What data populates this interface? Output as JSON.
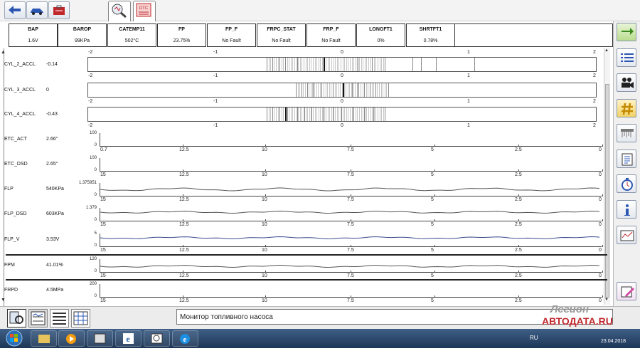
{
  "toolbar": {
    "icons": [
      "back-arrow-icon",
      "car-icon",
      "toolbox-icon",
      "datalogger-icon",
      "dtc-icon"
    ],
    "dtc_label": "DTC"
  },
  "header": [
    {
      "label": "BAP",
      "value": "1.6V"
    },
    {
      "label": "BAROP",
      "value": "99KPa"
    },
    {
      "label": "CATEMP11",
      "value": "502°C"
    },
    {
      "label": "FP",
      "value": "23.75%"
    },
    {
      "label": "FP_F",
      "value": "No Fault"
    },
    {
      "label": "FRPC_STAT",
      "value": "No Fault"
    },
    {
      "label": "FRP_F",
      "value": "No Fault"
    },
    {
      "label": "LONGFT1",
      "value": "0%"
    },
    {
      "label": "SHRTFT1",
      "value": "0.78%"
    }
  ],
  "accel_axis_ticks": [
    "-2",
    "-1",
    "0",
    "1",
    "2"
  ],
  "time_axis_ticks": [
    "12.5",
    "10",
    "7.5",
    "5",
    "2.5",
    "0"
  ],
  "accel_signals": [
    {
      "label": "CYL_2_ACCL",
      "value": "-0.14"
    },
    {
      "label": "CYL_3_ACCL",
      "value": "0"
    },
    {
      "label": "CYL_4_ACCL",
      "value": "-0.43"
    }
  ],
  "time_signals": [
    {
      "label": "ETC_ACT",
      "value": "2.66°",
      "ymax": "100",
      "ymin": "0",
      "xstart": "0.7"
    },
    {
      "label": "ETC_DSD",
      "value": "2.65°",
      "ymax": "100",
      "ymin": "0",
      "xstart": "15"
    },
    {
      "label": "FLP",
      "value": "540KPa",
      "ymax": "1.375951",
      "ymin": "0",
      "xstart": "15"
    },
    {
      "label": "FLP_DSD",
      "value": "603KPa",
      "ymax": "1.379",
      "ymin": "0",
      "xstart": "15"
    },
    {
      "label": "FLP_V",
      "value": "3.53V",
      "ymax": "5",
      "ymin": "0",
      "xstart": "15"
    },
    {
      "label": "FPM",
      "value": "41.01%",
      "ymax": "120",
      "ymin": "0",
      "xstart": "15"
    },
    {
      "label": "FRPD",
      "value": "4.5MPa",
      "ymax": "200",
      "ymin": "0",
      "xstart": "15"
    }
  ],
  "status_text": "Монитор топливного насоса",
  "watermark": {
    "line1": "Легион",
    "line2": "АВТОДАТА.RU",
    "date": "23.04.2018"
  },
  "taskbar": {
    "lang": "RU"
  },
  "colors": {
    "trace": "#3b4a8c",
    "tick_line": "#444444",
    "brand_red": "#c0282d",
    "status_bg": "#ffffff"
  }
}
